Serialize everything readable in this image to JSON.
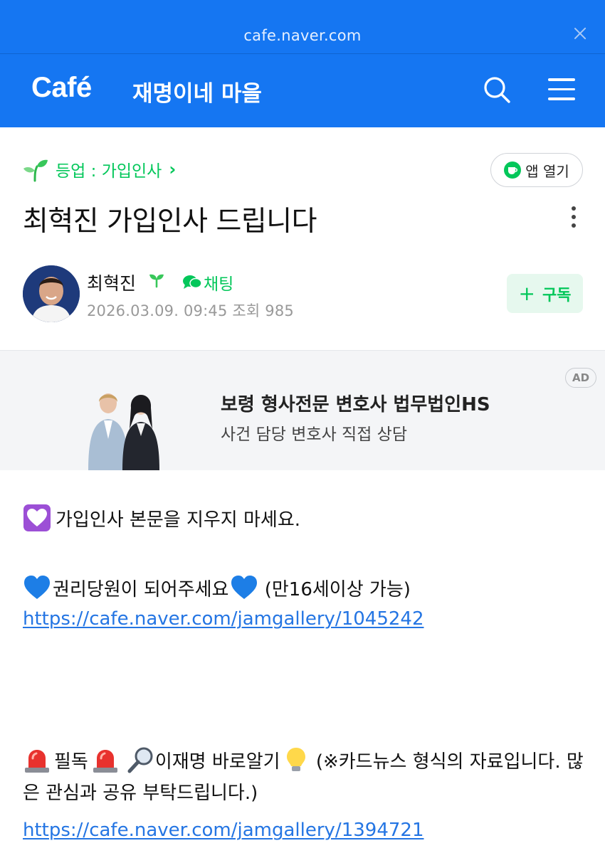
{
  "browser": {
    "url": "cafe.naver.com"
  },
  "header": {
    "logo": "Café",
    "cafe_name": "재명이네 마을"
  },
  "post": {
    "breadcrumb": "등업 : 가입인사",
    "open_app_label": "앱 열기",
    "title": "최혁진 가입인사 드립니다",
    "author": "최혁진",
    "chat_label": "채팅",
    "meta": "2026.03.09. 09:45  조회 985",
    "subscribe_label": "구독"
  },
  "ad": {
    "title": "보령 형사전문 변호사 법무법인HS",
    "subtitle": "사건 담당 변호사 직접 상담",
    "badge": "AD"
  },
  "content": {
    "line1": "가입인사 본문을 지우지 마세요.",
    "line2_text": "권리당원이 되어주세요",
    "line2_suffix": " (만16세이상 가능)",
    "link1": "https://cafe.naver.com/jamgallery/1045242",
    "line3_a": "필독",
    "line3_b": "이재명 바로알기",
    "line3_c": "  (※카드뉴스 형식의 자료입니다. 많은 관심과 공유 부탁드립니다.)",
    "link2": "https://cafe.naver.com/jamgallery/1394721"
  },
  "colors": {
    "brand_blue": "#1576f2",
    "naver_green": "#03c75a",
    "link_blue": "#2475e3"
  }
}
